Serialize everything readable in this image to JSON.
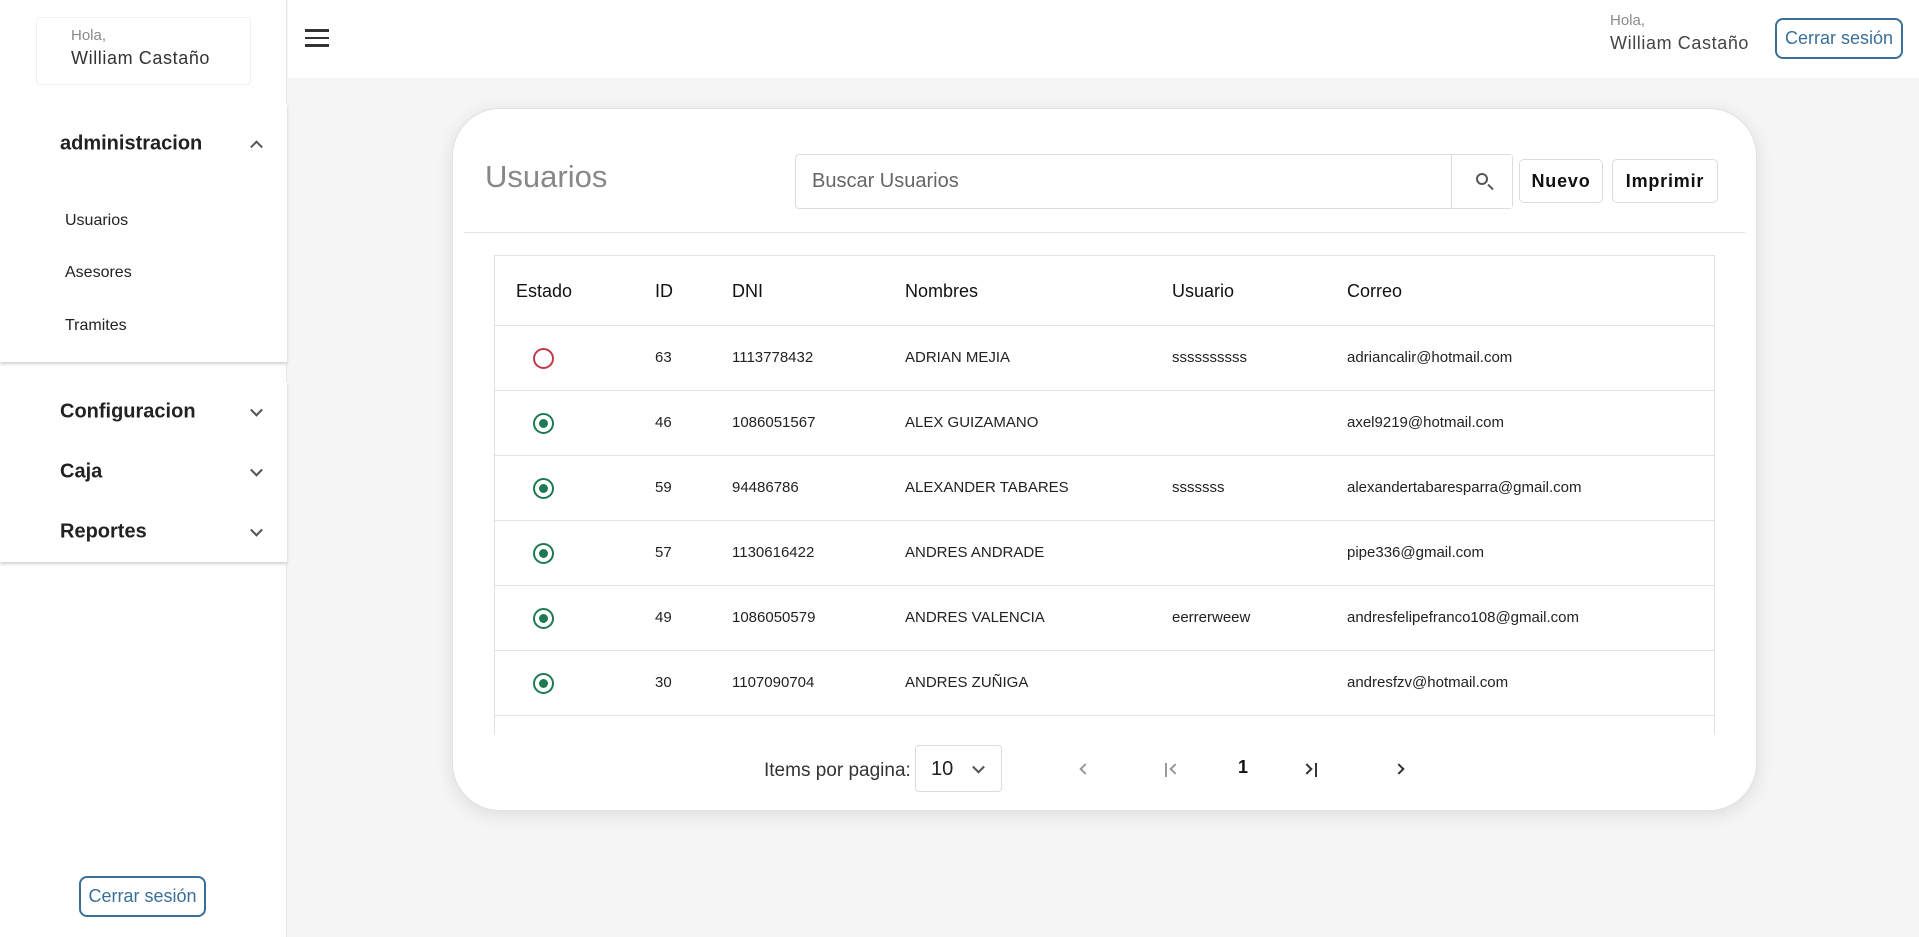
{
  "sidebar": {
    "greeting": "Hola,",
    "user_name": "William Castaño",
    "sections": [
      {
        "label": "administracion",
        "expanded": true,
        "items": [
          {
            "label": "Usuarios"
          },
          {
            "label": "Asesores"
          },
          {
            "label": "Tramites"
          }
        ]
      },
      {
        "label": "Configuracion",
        "expanded": false
      },
      {
        "label": "Caja",
        "expanded": false
      },
      {
        "label": "Reportes",
        "expanded": false
      }
    ],
    "logout_label": "Cerrar sesión"
  },
  "topbar": {
    "greeting": "Hola,",
    "user_name": "William Castaño",
    "logout_label": "Cerrar sesión"
  },
  "main": {
    "title": "Usuarios",
    "search_placeholder": "Buscar Usuarios",
    "new_label": "Nuevo",
    "print_label": "Imprimir",
    "table": {
      "columns": [
        "Estado",
        "ID",
        "DNI",
        "Nombres",
        "Usuario",
        "Correo"
      ],
      "rows": [
        {
          "estado": "inactive",
          "id": "63",
          "dni": "1113778432",
          "nombres": "ADRIAN MEJIA",
          "usuario": "ssssssssss",
          "correo": "adriancalir@hotmail.com"
        },
        {
          "estado": "active",
          "id": "46",
          "dni": "1086051567",
          "nombres": "ALEX GUIZAMANO",
          "usuario": "",
          "correo": "axel9219@hotmail.com"
        },
        {
          "estado": "active",
          "id": "59",
          "dni": "94486786",
          "nombres": "ALEXANDER TABARES",
          "usuario": "sssssss",
          "correo": "alexandertabaresparra@gmail.com"
        },
        {
          "estado": "active",
          "id": "57",
          "dni": "1130616422",
          "nombres": "ANDRES ANDRADE",
          "usuario": "",
          "correo": "pipe336@gmail.com"
        },
        {
          "estado": "active",
          "id": "49",
          "dni": "1086050579",
          "nombres": "ANDRES VALENCIA",
          "usuario": "eerrerweew",
          "correo": "andresfelipefranco108@gmail.com"
        },
        {
          "estado": "active",
          "id": "30",
          "dni": "1107090704",
          "nombres": "ANDRES ZUÑIGA",
          "usuario": "",
          "correo": "andresfzv@hotmail.com"
        }
      ]
    },
    "paginator": {
      "items_label": "Items por pagina:",
      "page_size": "10",
      "current_page": "1"
    }
  },
  "colors": {
    "accent": "#3a6f9a",
    "status_active": "#1e7a52",
    "status_inactive": "#c0394b"
  }
}
